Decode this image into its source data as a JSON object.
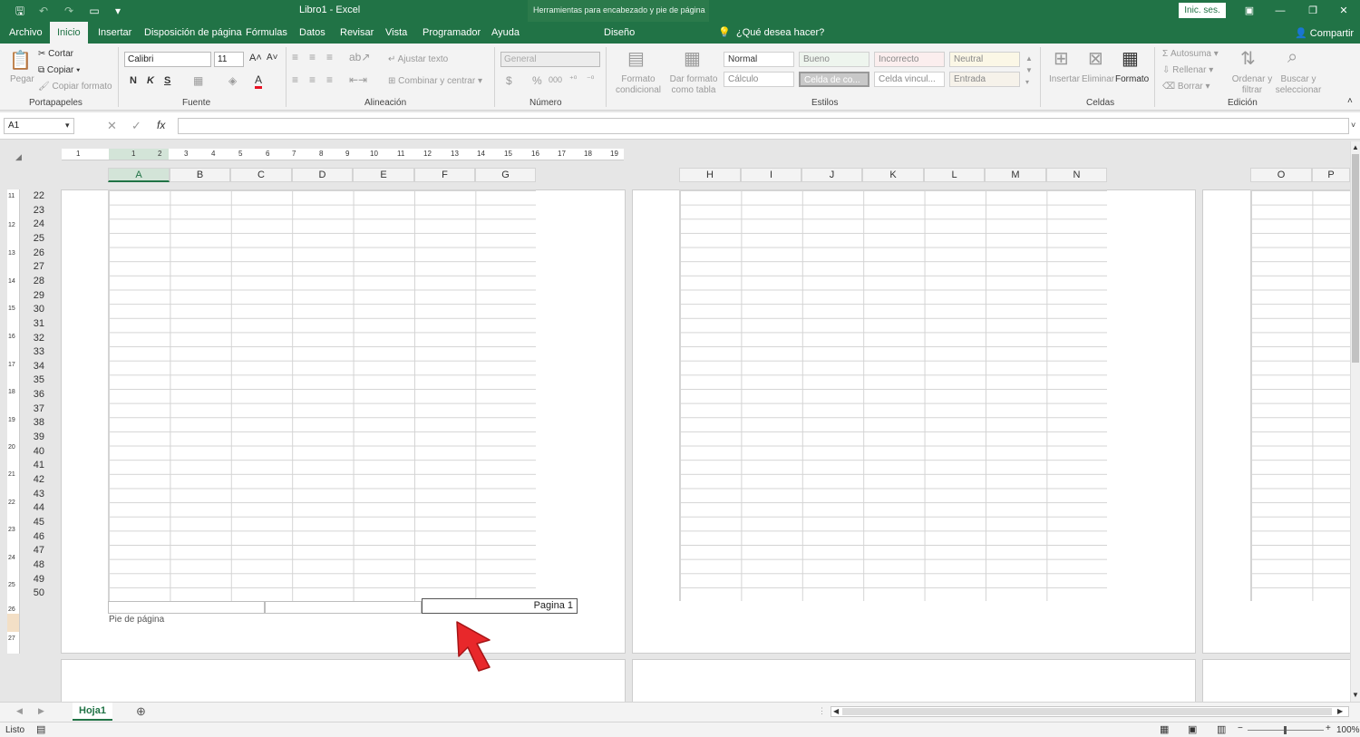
{
  "titlebar": {
    "title": "Libro1 - Excel",
    "tools": "Herramientas para encabezado y pie de página",
    "login": "Inic. ses."
  },
  "tabs": [
    "Archivo",
    "Inicio",
    "Insertar",
    "Disposición de página",
    "Fórmulas",
    "Datos",
    "Revisar",
    "Vista",
    "Programador",
    "Ayuda"
  ],
  "design_tab": "Diseño",
  "ask": "¿Qué desea hacer?",
  "share": "Compartir",
  "clipboard": {
    "paste": "Pegar",
    "cut": "Cortar",
    "copy": "Copiar",
    "format_painter": "Copiar formato",
    "label": "Portapapeles"
  },
  "font": {
    "name": "Calibri",
    "size": "11",
    "bold": "N",
    "italic": "K",
    "underline": "S",
    "label": "Fuente"
  },
  "alignment": {
    "wrap": "Ajustar texto",
    "merge": "Combinar y centrar",
    "label": "Alineación"
  },
  "number": {
    "format": "General",
    "currency": "$",
    "percent": "%",
    "thousands": "000",
    "label": "Número"
  },
  "styles": {
    "cond_format": "Formato condicional",
    "table_format": "Dar formato como tabla",
    "cells": [
      "Normal",
      "Bueno",
      "Incorrecto",
      "Neutral",
      "Cálculo",
      "Celda de co...",
      "Celda vincul...",
      "Entrada"
    ],
    "label": "Estilos"
  },
  "cells_group": {
    "insert": "Insertar",
    "delete": "Eliminar",
    "format": "Formato",
    "label": "Celdas"
  },
  "editing": {
    "autosum": "Autosuma",
    "fill": "Rellenar",
    "clear": "Borrar",
    "sort": "Ordenar y filtrar",
    "find": "Buscar y seleccionar",
    "label": "Edición"
  },
  "namebox": "A1",
  "fx": "fx",
  "columns_p1": [
    "A",
    "B",
    "C",
    "D",
    "E",
    "F",
    "G"
  ],
  "columns_p2": [
    "H",
    "I",
    "J",
    "K",
    "L",
    "M",
    "N"
  ],
  "columns_p3": [
    "O",
    "P"
  ],
  "rows": [
    "22",
    "23",
    "24",
    "25",
    "26",
    "27",
    "28",
    "29",
    "30",
    "31",
    "32",
    "33",
    "34",
    "35",
    "36",
    "37",
    "38",
    "39",
    "40",
    "41",
    "42",
    "43",
    "44",
    "45",
    "46",
    "47",
    "48",
    "49",
    "50"
  ],
  "ruler_h": [
    "1",
    "1",
    "2",
    "3",
    "4",
    "5",
    "6",
    "7",
    "8",
    "9",
    "10",
    "11",
    "12",
    "13",
    "14",
    "15",
    "16",
    "17",
    "18",
    "19"
  ],
  "ruler_v": [
    "11",
    "12",
    "13",
    "14",
    "15",
    "16",
    "17",
    "18",
    "19",
    "20",
    "21",
    "22",
    "23",
    "24",
    "25",
    "26",
    "27"
  ],
  "footer": {
    "text": "Pagina 1",
    "label": "Pie de página"
  },
  "sheet": {
    "name": "Hoja1"
  },
  "status": {
    "ready": "Listo",
    "zoom": "100%"
  }
}
